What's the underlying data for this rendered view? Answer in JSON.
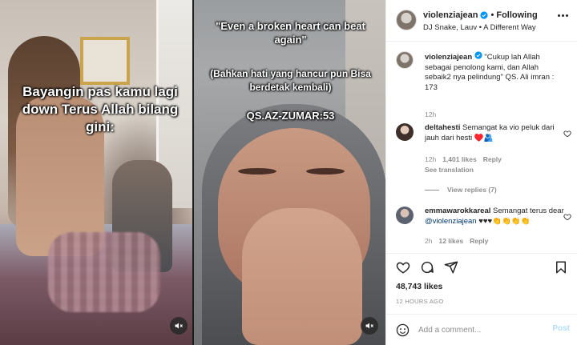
{
  "media": {
    "panel1_text": "Bayangin pas kamu lagi down Terus Allah bilang gini:",
    "panel2_quote_en": "\"Even a broken heart can beat again\"",
    "panel2_quote_id": "(Bahkan hati yang hancur pun Bisa berdetak kembali)",
    "panel2_ref": "QS.AZ-ZUMAR:53",
    "mute_icon": "speaker-muted-icon"
  },
  "header": {
    "username": "violenziajean",
    "separator": "•",
    "follow_state": "Following",
    "audio": "DJ Snake, Lauv • A Different Way",
    "more_icon": "more-horizontal-icon"
  },
  "caption": {
    "username": "violenziajean",
    "text": "\"Cukup lah Allah sebagai penolong kami, dan Allah sebaik2 nya pelindung\" QS. Ali imran : 173",
    "time": "12h"
  },
  "comments": [
    {
      "username": "deltahesti",
      "text": "Semangat ka vio peluk dari jauh dari hesti ♥️🫂",
      "time": "12h",
      "likes": "1,401 likes",
      "reply": "Reply",
      "see_translation": "See translation",
      "view_replies": "View replies (7)"
    },
    {
      "username": "emmawarokkareal",
      "text_before": "Semangat terus dear ",
      "mention": "@violenziajean",
      "text_after": " ♥♥♥👏👏👏👏",
      "time": "2h",
      "likes": "12 likes",
      "reply": "Reply"
    }
  ],
  "actions": {
    "likes": "48,743 likes",
    "time_ago": "12 HOURS AGO"
  },
  "comment_box": {
    "placeholder": "Add a comment...",
    "post_label": "Post"
  },
  "colors": {
    "verified": "#0095f6",
    "link": "#00376b",
    "muted_text": "#8e8e8e",
    "heart_red": "#ed4956",
    "post_disabled": "#b2dffc"
  }
}
